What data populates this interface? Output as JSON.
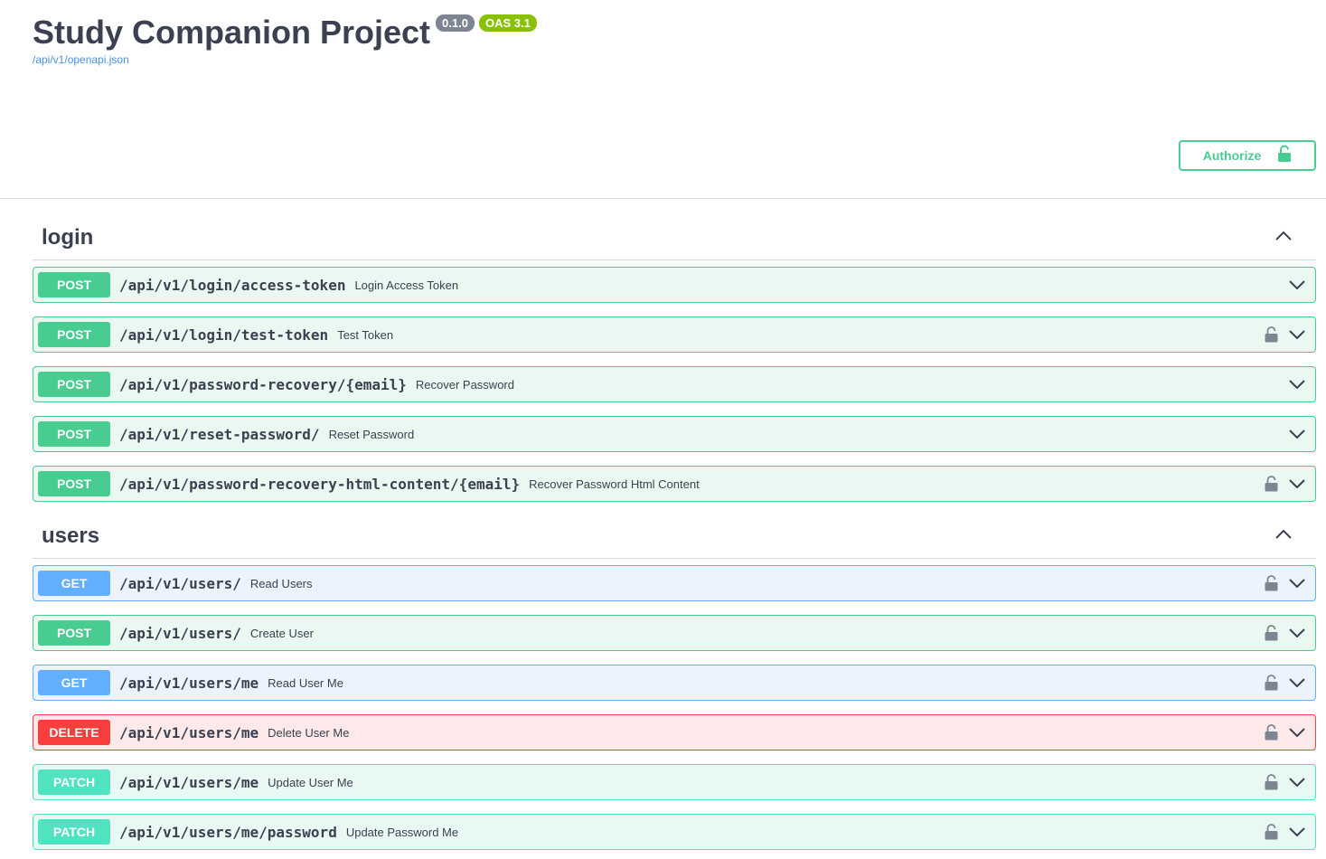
{
  "header": {
    "title": "Study Companion Project",
    "version_badge": "0.1.0",
    "oas_badge": "OAS 3.1",
    "spec_link": "/api/v1/openapi.json",
    "authorize_label": "Authorize"
  },
  "colors": {
    "post": "#49cc90",
    "get": "#61affe",
    "delete": "#f93e3e",
    "patch": "#50e3c2"
  },
  "sections": [
    {
      "name": "login",
      "operations": [
        {
          "method": "POST",
          "path": "/api/v1/login/access-token",
          "summary": "Login Access Token",
          "locked": false
        },
        {
          "method": "POST",
          "path": "/api/v1/login/test-token",
          "summary": "Test Token",
          "locked": true
        },
        {
          "method": "POST",
          "path": "/api/v1/password-recovery/{email}",
          "summary": "Recover Password",
          "locked": false
        },
        {
          "method": "POST",
          "path": "/api/v1/reset-password/",
          "summary": "Reset Password",
          "locked": false
        },
        {
          "method": "POST",
          "path": "/api/v1/password-recovery-html-content/{email}",
          "summary": "Recover Password Html Content",
          "locked": true
        }
      ]
    },
    {
      "name": "users",
      "operations": [
        {
          "method": "GET",
          "path": "/api/v1/users/",
          "summary": "Read Users",
          "locked": true
        },
        {
          "method": "POST",
          "path": "/api/v1/users/",
          "summary": "Create User",
          "locked": true
        },
        {
          "method": "GET",
          "path": "/api/v1/users/me",
          "summary": "Read User Me",
          "locked": true
        },
        {
          "method": "DELETE",
          "path": "/api/v1/users/me",
          "summary": "Delete User Me",
          "locked": true
        },
        {
          "method": "PATCH",
          "path": "/api/v1/users/me",
          "summary": "Update User Me",
          "locked": true
        },
        {
          "method": "PATCH",
          "path": "/api/v1/users/me/password",
          "summary": "Update Password Me",
          "locked": true
        }
      ]
    }
  ]
}
